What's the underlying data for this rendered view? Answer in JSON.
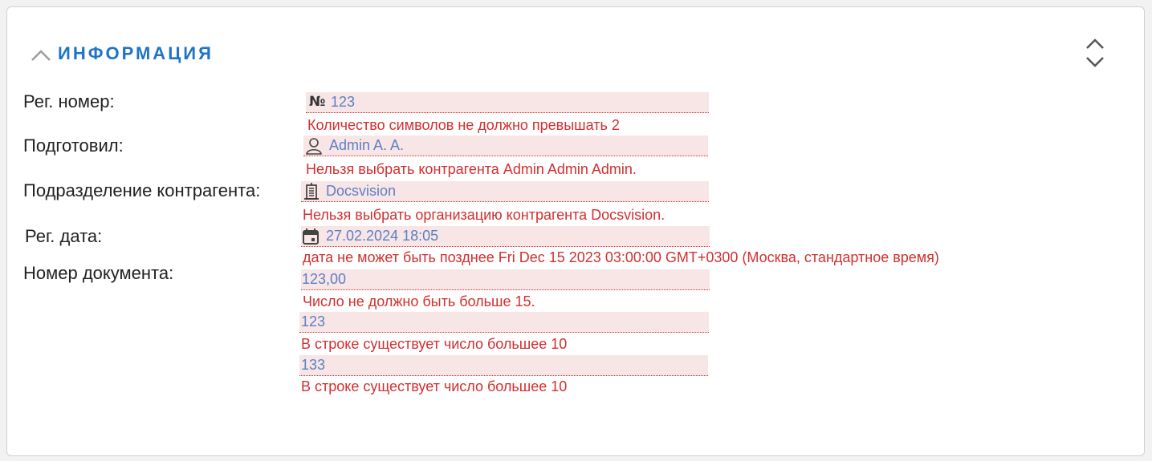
{
  "section": {
    "title": "ИНФОРМАЦИЯ",
    "accent_color": "#1e73c9",
    "collapse_icon": "chevron-up-icon",
    "sort_icon": "expand-collapse-icon"
  },
  "labels": {
    "reg_number": "Рег. номер:",
    "prepared_by": "Подготовил:",
    "department": "Подразделение контрагента:",
    "reg_date": "Рег. дата:",
    "doc_number": "Номер документа:"
  },
  "fields": {
    "reg_number": {
      "icon": "number-sign-icon",
      "icon_glyph": "№",
      "value": "123",
      "error": "Количество символов не должно превышать 2"
    },
    "prepared_by": {
      "icon": "user-icon",
      "value": "Admin A. A.",
      "error": "Нельзя выбрать контрагента Admin Admin Admin."
    },
    "department": {
      "icon": "building-icon",
      "value": "Docsvision",
      "error": "Нельзя выбрать организацию контрагента Docsvision."
    },
    "reg_date": {
      "icon": "calendar-icon",
      "value": "27.02.2024 18:05",
      "error": "дата не может быть позднее Fri Dec 15 2023 03:00:00 GMT+0300 (Москва, стандартное время)"
    },
    "doc_number_1": {
      "value": "123,00",
      "error": "Число не должно быть больше 15."
    },
    "doc_number_2": {
      "value": "123",
      "error": "В строке существует число большее 10"
    },
    "doc_number_3": {
      "value": "133",
      "error": "В строке существует число большее 10"
    }
  },
  "colors": {
    "error": "#d32f2f",
    "invalid_background": "#f8e6e7",
    "value_text": "#5b7fc4"
  }
}
